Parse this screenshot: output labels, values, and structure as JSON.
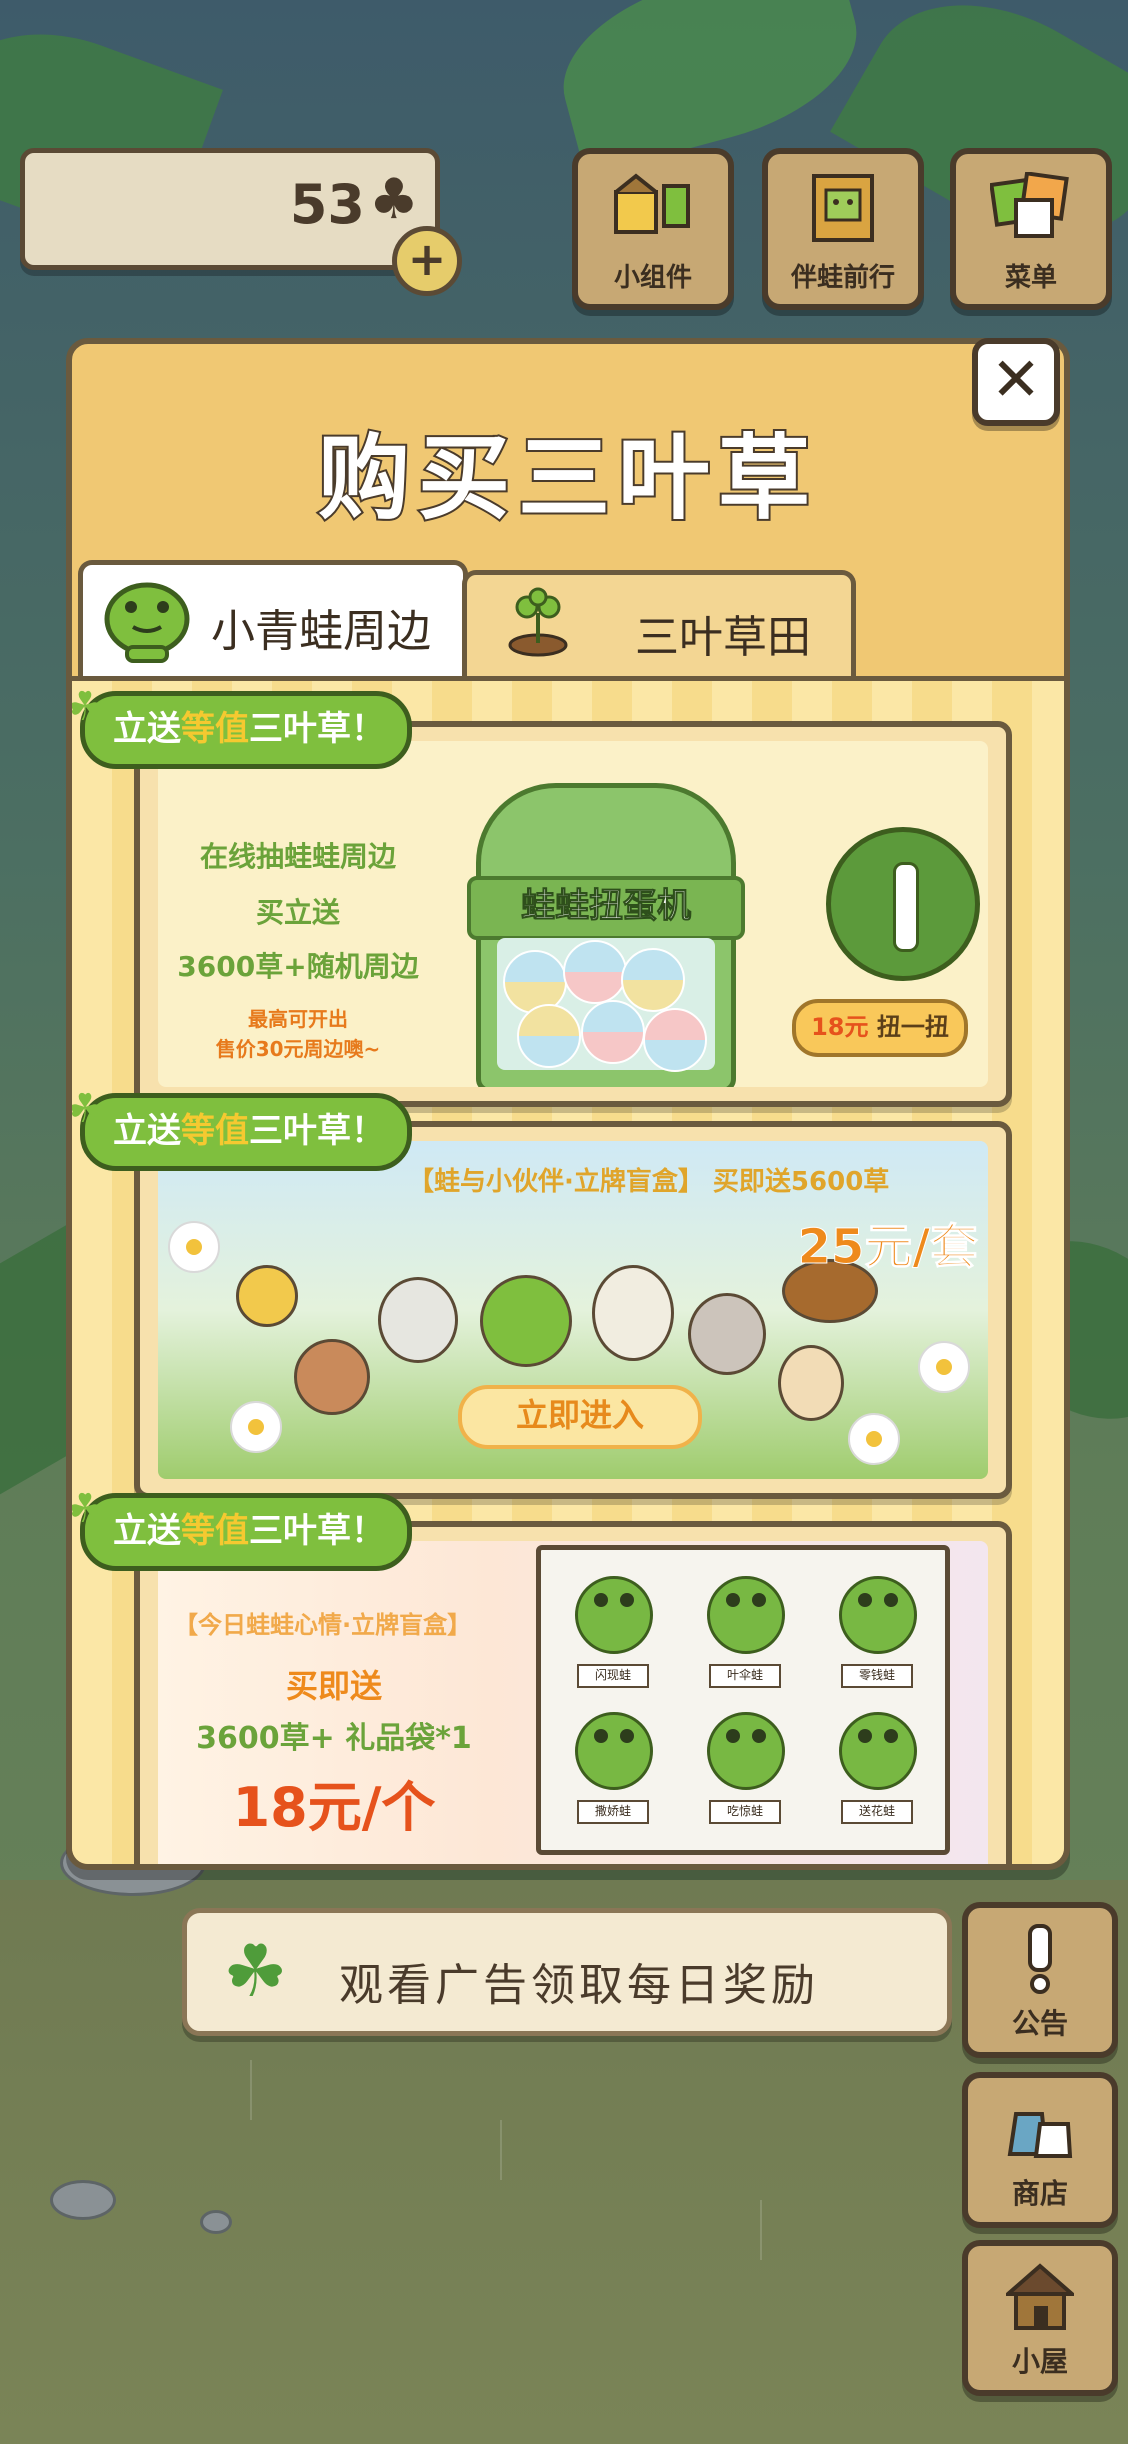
{
  "hud": {
    "clover_count": "53",
    "buttons": [
      {
        "label": "小组件",
        "icon": "widget-icon"
      },
      {
        "label": "伴蛙前行",
        "icon": "frog-book-icon"
      },
      {
        "label": "菜单",
        "icon": "menu-papers-icon"
      }
    ]
  },
  "side_buttons": [
    {
      "label": "公告",
      "icon": "exclamation-icon"
    },
    {
      "label": "商店",
      "icon": "shop-bags-icon"
    },
    {
      "label": "小屋",
      "icon": "house-icon"
    }
  ],
  "modal": {
    "title": "购买三叶草",
    "tabs": [
      {
        "label": "小青蛙周边",
        "active": true
      },
      {
        "label": "三叶草田",
        "active": false
      }
    ],
    "cards": [
      {
        "ribbon": {
          "pre": "立送",
          "highlight": "等值",
          "post": "三叶草！"
        },
        "lines": [
          "在线抽蛙蛙周边",
          "买立送",
          "3600草+随机周边"
        ],
        "small_lines": [
          "最高可开出",
          "售价30元周边噢~"
        ],
        "machine_title": "蛙蛙扭蛋机",
        "price": "18元",
        "action": "扭一扭"
      },
      {
        "ribbon": {
          "pre": "立送",
          "highlight": "等值",
          "post": "三叶草！"
        },
        "headline": "【蛙与小伙伴·立牌盲盒】 买即送5600草",
        "price": "25元/套",
        "button": "立即进入"
      },
      {
        "ribbon": {
          "pre": "立送",
          "highlight": "等值",
          "post": "三叶草！"
        },
        "headline": "【今日蛙蛙心情·立牌盲盒】",
        "line1": "买即送",
        "line2": "3600草+ 礼品袋*1",
        "price": "18元/个",
        "frogs": [
          "闪现蛙",
          "叶伞蛙",
          "零钱蛙",
          "撒娇蛙",
          "吃惊蛙",
          "送花蛙"
        ]
      }
    ]
  },
  "ad_banner": {
    "label": "观看广告领取每日奖励"
  },
  "colors": {
    "modal_bg": "#f0c873",
    "ribbon_green": "#7fbf3e",
    "price_orange": "#ee8a1c",
    "title_outline": "#4a3b2b"
  }
}
